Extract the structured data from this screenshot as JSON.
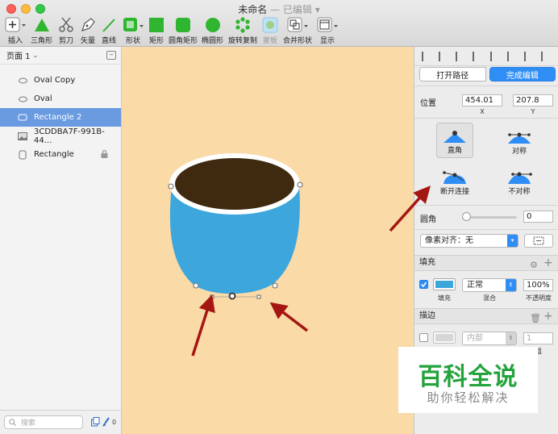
{
  "window": {
    "title": "未命名",
    "subtitle": "— 已编辑 ▾"
  },
  "toolbar": {
    "items": [
      {
        "label": "插入",
        "icon": "plus-icon"
      },
      {
        "label": "三角形",
        "icon": "triangle-icon"
      },
      {
        "label": "剪刀",
        "icon": "scissors-icon"
      },
      {
        "label": "矢量",
        "icon": "pen-icon"
      },
      {
        "label": "直线",
        "icon": "line-icon"
      },
      {
        "label": "形状",
        "icon": "shapes-icon"
      },
      {
        "label": "矩形",
        "icon": "rectangle-icon"
      },
      {
        "label": "圆角矩形",
        "icon": "rounded-rectangle-icon"
      },
      {
        "label": "椭圆形",
        "icon": "oval-icon"
      },
      {
        "label": "旋转复制",
        "icon": "rotate-copy-icon"
      },
      {
        "label": "蒙板",
        "icon": "mask-icon"
      },
      {
        "label": "合并形状",
        "icon": "combine-shapes-icon"
      },
      {
        "label": "显示",
        "icon": "view-icon"
      }
    ]
  },
  "sidebar": {
    "page_label": "页面 1",
    "layers": [
      {
        "name": "Oval Copy",
        "icon": "oval-layer-icon",
        "selected": false,
        "locked": false
      },
      {
        "name": "Oval",
        "icon": "oval-layer-icon",
        "selected": false,
        "locked": false
      },
      {
        "name": "Rectangle 2",
        "icon": "rect-layer-icon",
        "selected": true,
        "locked": false
      },
      {
        "name": "3CDDBA7F-991B-44...",
        "icon": "image-layer-icon",
        "selected": false,
        "locked": false
      },
      {
        "name": "Rectangle",
        "icon": "rect-layer-icon",
        "selected": false,
        "locked": true
      }
    ],
    "search_placeholder": "搜索",
    "filter_count": "0"
  },
  "inspector": {
    "open_path": "打开路径",
    "finish_edit": "完成编辑",
    "position_label": "位置",
    "x_value": "454.01",
    "y_value": "207.8",
    "x_label": "X",
    "y_label": "Y",
    "point_types": [
      "直角",
      "对称",
      "断开连接",
      "不对称"
    ],
    "corner_label": "圆角",
    "corner_value": "0",
    "corner_slider_value": 0,
    "pixel_align": "像素对齐：无",
    "fill_section": "填充",
    "fill_color": "#3da7dd",
    "fill_enabled": true,
    "fill_blend": "正常",
    "fill_opacity": "100%",
    "fill_col_labels": [
      "填充",
      "混合",
      "不透明度"
    ],
    "border_section": "描边",
    "border_enabled": false,
    "border_position": "内部",
    "border_width": "1",
    "border_width_label": "粗"
  },
  "canvas": {
    "background": "#fadaa7",
    "cup_color": "#3da7dd",
    "coffee_color": "#3f2a10",
    "arrow_color": "#a41612"
  },
  "watermark": {
    "big": "百科全说",
    "small": "助你轻松解决"
  }
}
